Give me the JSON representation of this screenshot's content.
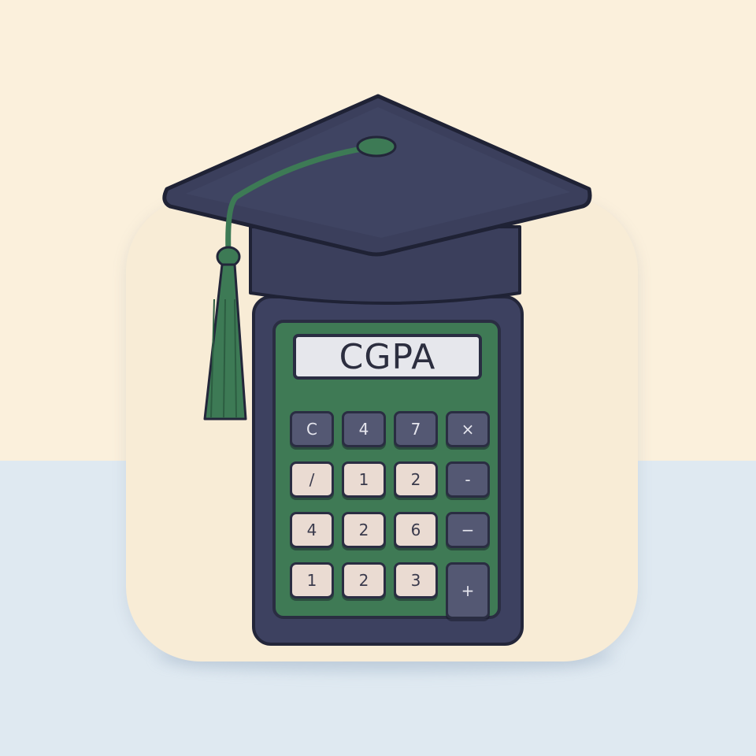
{
  "app_icon": {
    "display_text": "CGPA",
    "keys": [
      {
        "label": "C",
        "style": "dark"
      },
      {
        "label": "4",
        "style": "dark"
      },
      {
        "label": "7",
        "style": "dark"
      },
      {
        "label": "×",
        "style": "dark"
      },
      {
        "label": "/",
        "style": "light"
      },
      {
        "label": "1",
        "style": "light"
      },
      {
        "label": "2",
        "style": "light"
      },
      {
        "label": "-",
        "style": "dark"
      },
      {
        "label": "4",
        "style": "light"
      },
      {
        "label": "2",
        "style": "light"
      },
      {
        "label": "6",
        "style": "light"
      },
      {
        "label": "−",
        "style": "dark"
      },
      {
        "label": "1",
        "style": "light"
      },
      {
        "label": "2",
        "style": "light"
      },
      {
        "label": "3",
        "style": "light"
      },
      {
        "label": "+",
        "style": "dark"
      }
    ],
    "colors": {
      "background_top": "#fbf0dc",
      "background_bottom": "#dfe9f1",
      "tile": "#f8ecd6",
      "calculator_body": "#3d4160",
      "calculator_face": "#3f7a55",
      "cap": "#3b3f5c",
      "tassel": "#3d7a55"
    },
    "icons": [
      "graduation-cap-icon",
      "calculator-icon",
      "tassel-icon"
    ]
  }
}
